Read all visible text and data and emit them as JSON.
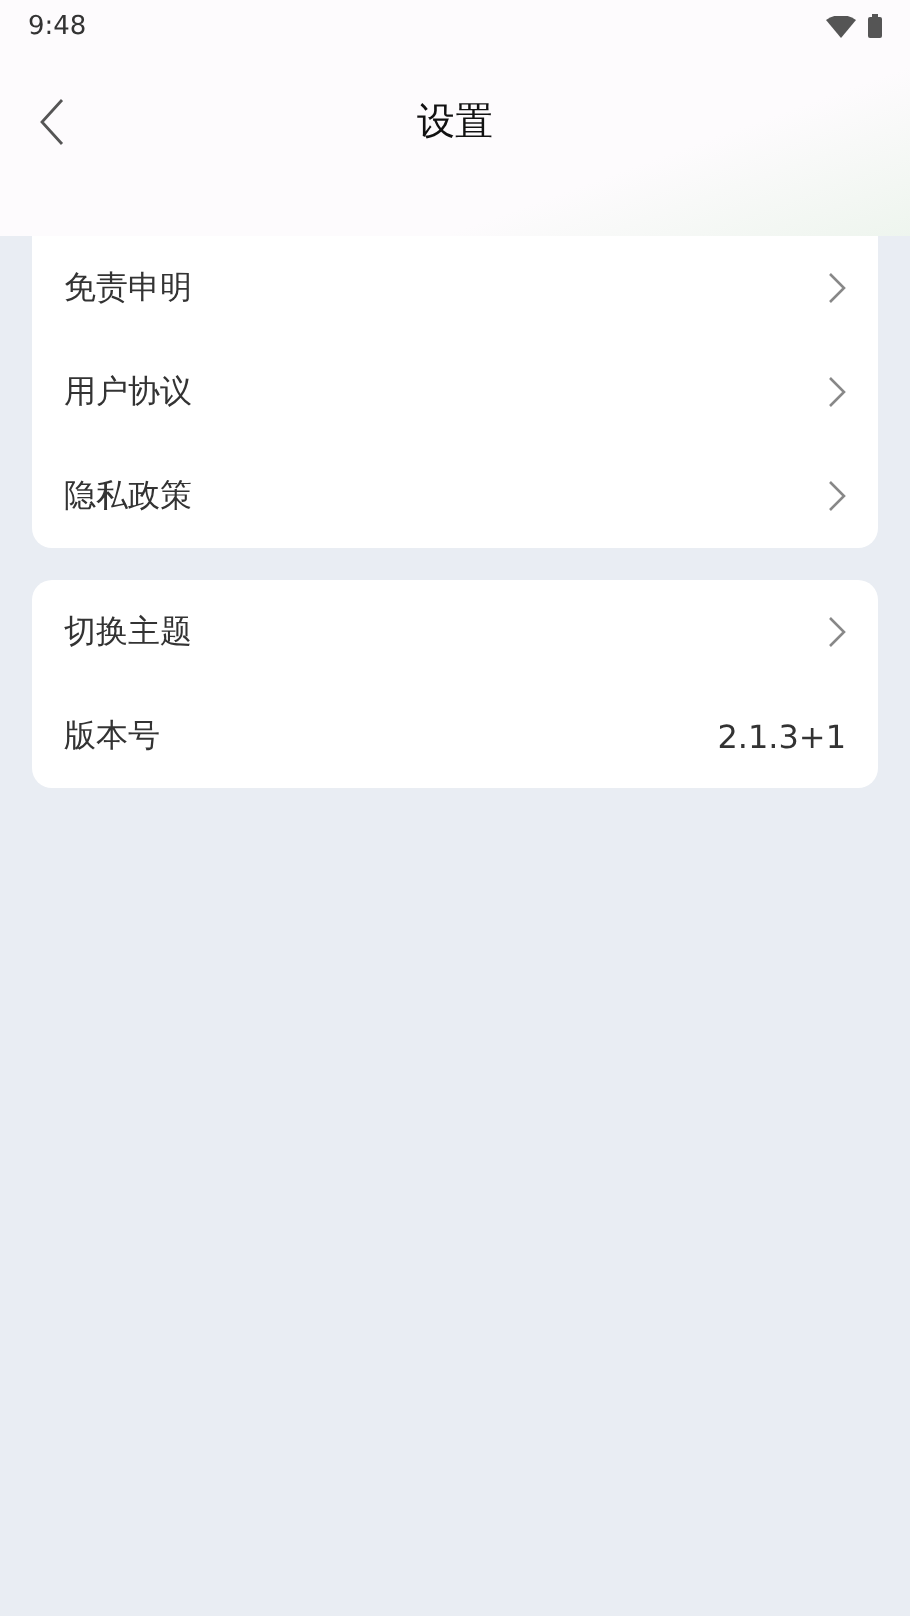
{
  "status_bar": {
    "time": "9:48"
  },
  "header": {
    "title": "设置"
  },
  "groups": [
    {
      "items": [
        {
          "kind": "link",
          "label": "免责申明"
        },
        {
          "kind": "link",
          "label": "用户协议"
        },
        {
          "kind": "link",
          "label": "隐私政策"
        }
      ]
    },
    {
      "items": [
        {
          "kind": "link",
          "label": "切换主题"
        },
        {
          "kind": "value",
          "label": "版本号",
          "value": "2.1.3+1"
        }
      ]
    }
  ]
}
